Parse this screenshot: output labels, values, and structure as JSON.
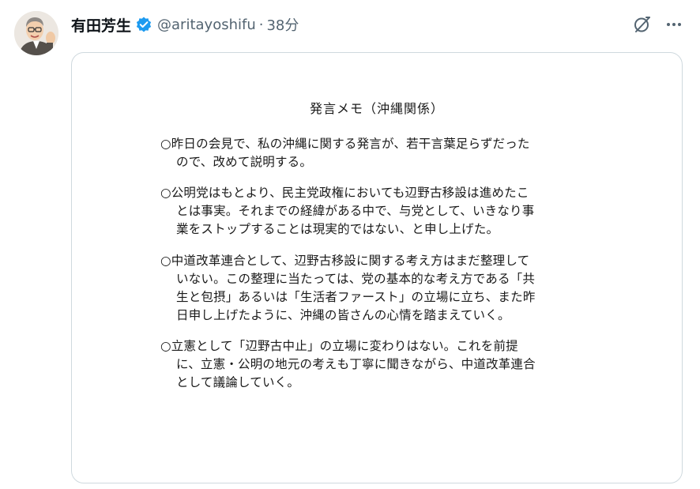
{
  "post": {
    "author_name": "有田芳生",
    "handle": "@aritayoshifu",
    "separator": "·",
    "time": "38分",
    "verified_color": "#1d9bf0"
  },
  "icons": {
    "grok": "grok-icon",
    "more": "more-horizontal-icon",
    "verified": "verified-badge-icon"
  },
  "memo": {
    "title": "発言メモ（沖縄関係）",
    "paragraphs": [
      {
        "lines": [
          "○昨日の会見で、私の沖縄に関する発言が、若干言葉足らずだった",
          "ので、改めて説明する。"
        ]
      },
      {
        "lines": [
          "○公明党はもとより、民主党政権においても辺野古移設は進めたこ",
          "とは事実。それまでの経緯がある中で、与党として、いきなり事",
          "業をストップすることは現実的ではない、と申し上げた。"
        ]
      },
      {
        "lines": [
          "○中道改革連合として、辺野古移設に関する考え方はまだ整理して",
          "いない。この整理に当たっては、党の基本的な考え方である「共",
          "生と包摂」あるいは「生活者ファースト」の立場に立ち、また昨",
          "日申し上げたように、沖縄の皆さんの心情を踏まえていく。"
        ]
      },
      {
        "lines": [
          "○立憲として「辺野古中止」の立場に変わりはない。これを前提",
          "に、立憲・公明の地元の考えも丁寧に聞きながら、中道改革連合",
          "として議論していく。"
        ]
      }
    ]
  }
}
